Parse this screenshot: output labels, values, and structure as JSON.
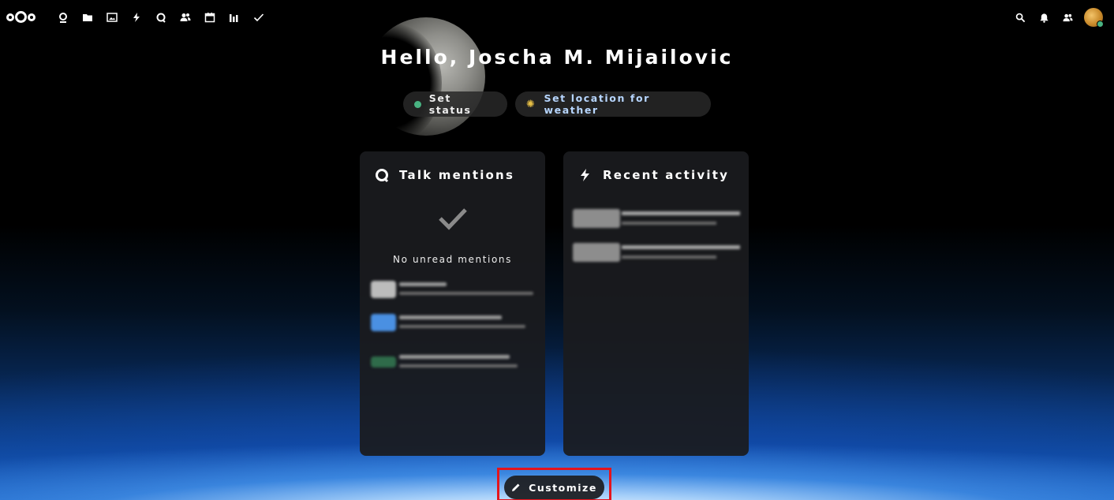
{
  "header": {
    "greeting": "Hello, Joscha M. Mijailovic"
  },
  "status": {
    "set_status_label": "Set status",
    "set_location_label": "Set location for weather",
    "status_color": "#49b382"
  },
  "topbar": {
    "apps": [
      "dashboard-icon",
      "files-icon",
      "photos-icon",
      "activity-icon",
      "talk-icon",
      "contacts-icon",
      "calendar-icon",
      "analytics-icon",
      "tasks-icon"
    ],
    "right": [
      "search-icon",
      "notifications-icon",
      "contacts-menu-icon",
      "avatar"
    ]
  },
  "widgets": {
    "talk": {
      "title": "Talk mentions",
      "empty_message": "No unread mentions"
    },
    "activity": {
      "title": "Recent activity"
    }
  },
  "footer": {
    "customize_label": "Customize"
  },
  "colors": {
    "highlight": "#e5141c",
    "online": "#49b382"
  }
}
